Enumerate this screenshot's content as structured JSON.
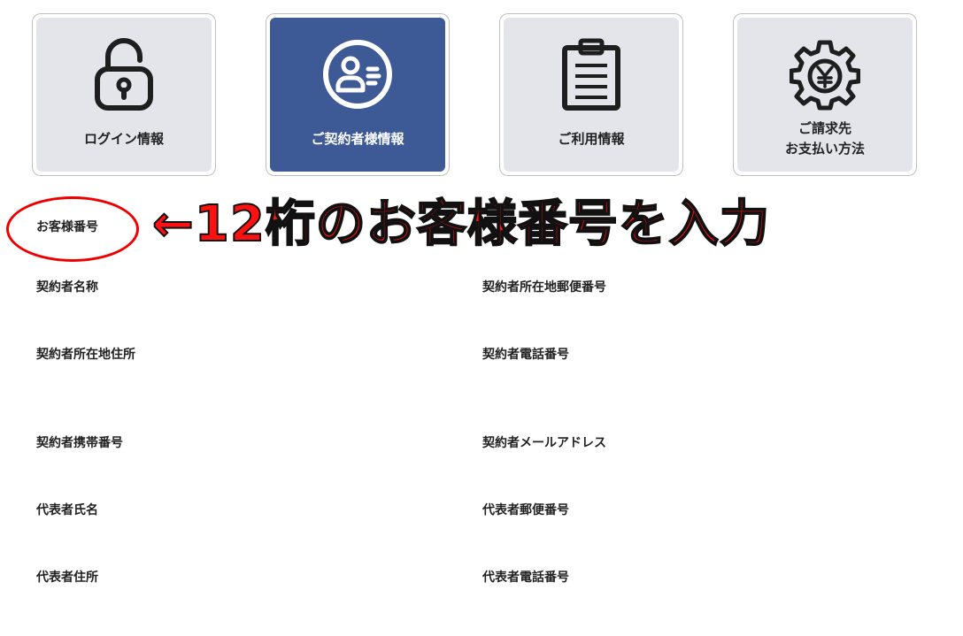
{
  "tabs": [
    {
      "id": "login",
      "label_lines": [
        "ログイン情報"
      ],
      "icon": "padlock-icon",
      "active": false
    },
    {
      "id": "contractor",
      "label_lines": [
        "ご契約者様情報"
      ],
      "icon": "user-card-icon",
      "active": true
    },
    {
      "id": "usage",
      "label_lines": [
        "ご利用情報"
      ],
      "icon": "clipboard-icon",
      "active": false
    },
    {
      "id": "billing",
      "label_lines": [
        "ご請求先",
        "お支払い方法"
      ],
      "icon": "yen-gear-icon",
      "active": false
    }
  ],
  "fields": {
    "customer_number": "お客様番号",
    "contractor_name": "契約者名称",
    "contractor_postal_code": "契約者所在地郵便番号",
    "contractor_address": "契約者所在地住所",
    "contractor_phone": "契約者電話番号",
    "contractor_mobile": "契約者携帯番号",
    "contractor_email": "契約者メールアドレス",
    "representative_name": "代表者氏名",
    "representative_postal_code": "代表者郵便番号",
    "representative_address": "代表者住所",
    "representative_phone": "代表者電話番号"
  },
  "annotation": {
    "text": "←12桁のお客様番号を入力",
    "color": "#ff1111"
  },
  "colors": {
    "active_tab": "#3e5a96",
    "inactive_tab": "#e3e5ea"
  }
}
